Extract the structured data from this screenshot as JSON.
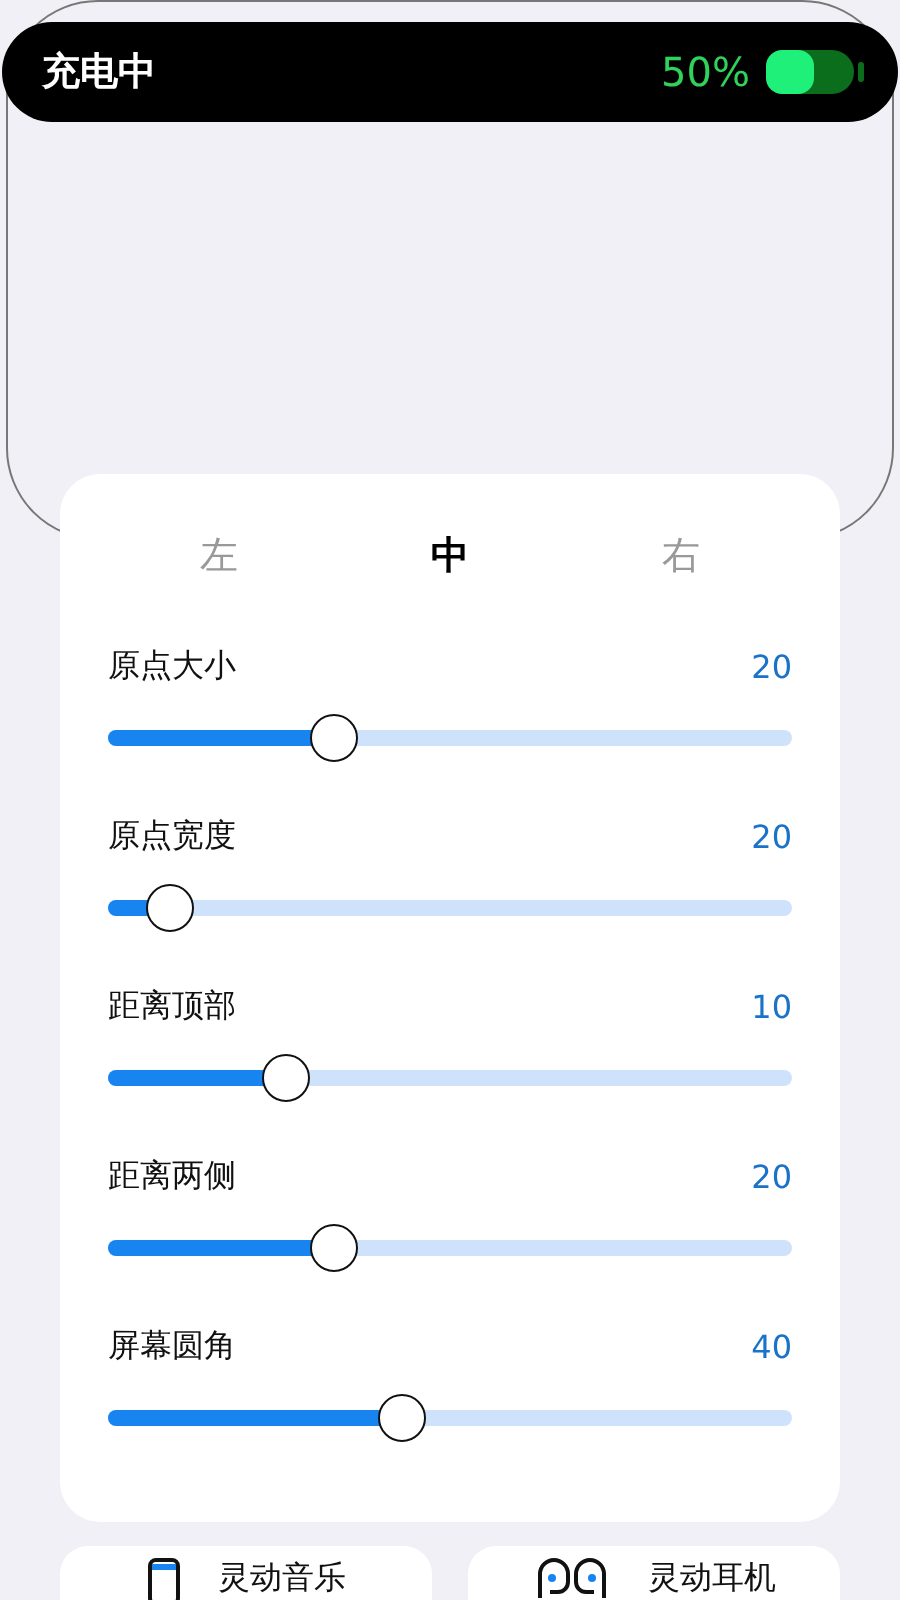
{
  "status_bar": {
    "label": "充电中",
    "percent": "50%"
  },
  "tabs": [
    {
      "label": "左",
      "selected": false
    },
    {
      "label": "中",
      "selected": true
    },
    {
      "label": "右",
      "selected": false
    }
  ],
  "sliders": [
    {
      "label": "原点大小",
      "reading": "20",
      "level": 0.33
    },
    {
      "label": "原点宽度",
      "reading": "20",
      "level": 0.09
    },
    {
      "label": "距离顶部",
      "reading": "10",
      "level": 0.26
    },
    {
      "label": "距离两侧",
      "reading": "20",
      "level": 0.33
    },
    {
      "label": "屏幕圆角",
      "reading": "40",
      "level": 0.43
    }
  ],
  "feature_cards": [
    {
      "kind": "music",
      "label": "灵动音乐"
    },
    {
      "kind": "earbuds",
      "label": "灵动耳机"
    }
  ]
}
